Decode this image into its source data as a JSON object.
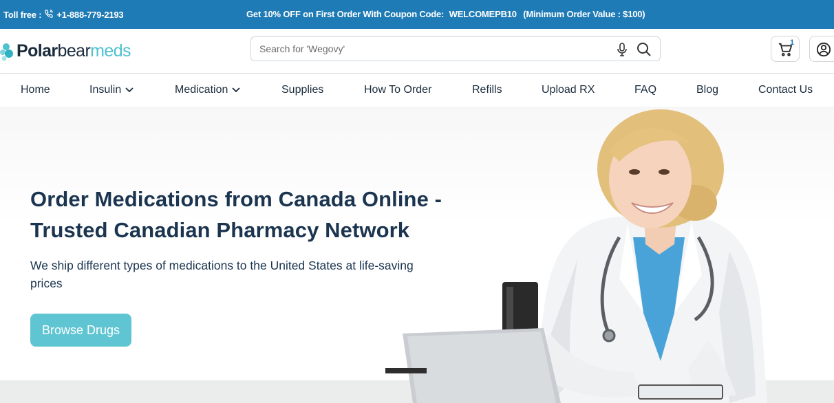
{
  "topbar": {
    "toll_label": "Toll free :",
    "phone": "+1-888-779-2193",
    "promo_text": "Get 10% OFF on First Order With Coupon Code:",
    "coupon_code": "WELCOMEPB10",
    "promo_note": "(Minimum Order Value : $100)"
  },
  "logo": {
    "part1": "Polar",
    "part2": "bear",
    "part3": "meds"
  },
  "search": {
    "placeholder": "Search for 'Wegovy'"
  },
  "cart": {
    "count": "1"
  },
  "nav": {
    "home": "Home",
    "insulin": "Insulin",
    "medication": "Medication",
    "supplies": "Supplies",
    "how_to_order": "How To Order",
    "refills": "Refills",
    "upload_rx": "Upload RX",
    "faq": "FAQ",
    "blog": "Blog",
    "contact": "Contact Us"
  },
  "hero": {
    "title": "Order Medications from Canada Online - Trusted Canadian Pharmacy Network",
    "subtitle": "We ship different types of medications to the United States at life-saving prices",
    "cta": "Browse Drugs"
  },
  "colors": {
    "topbar_bg": "#1f7bb5",
    "accent_teal": "#5fc5d2",
    "heading": "#1b3550"
  },
  "icons": [
    "phone-icon",
    "microphone-icon",
    "search-icon",
    "cart-icon",
    "user-icon",
    "chevron-down-icon"
  ]
}
